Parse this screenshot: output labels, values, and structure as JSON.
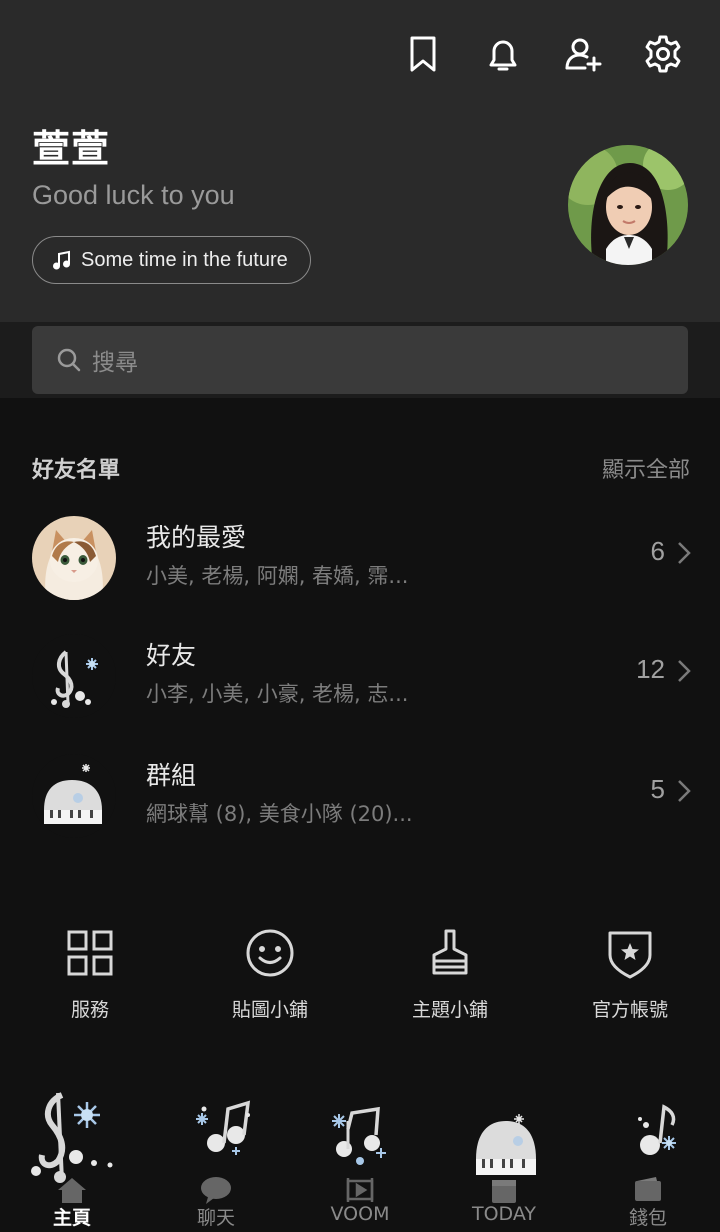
{
  "header": {
    "icons": [
      "bookmark-icon",
      "bell-icon",
      "add-friend-icon",
      "gear-icon"
    ],
    "profile_name": "萱萱",
    "status_message": "Good luck to you",
    "music": "Some time in the future"
  },
  "search": {
    "placeholder": "搜尋"
  },
  "friends": {
    "section_title": "好友名單",
    "show_all": "顯示全部",
    "rows": [
      {
        "title": "我的最愛",
        "subtitle": "小美, 老楊, 阿嫻, 春嬌, 霈...",
        "count": "6",
        "thumb": "cat-avatar"
      },
      {
        "title": "好友",
        "subtitle": "小李, 小美, 小豪, 老楊, 志...",
        "count": "12",
        "thumb": "music-note-theme-icon"
      },
      {
        "title": "群組",
        "subtitle": "網球幫 (8), 美食小隊 (20)...",
        "count": "5",
        "thumb": "snow-piano-theme-icon"
      }
    ]
  },
  "services": [
    {
      "label": "服務",
      "icon": "grid-icon"
    },
    {
      "label": "貼圖小鋪",
      "icon": "smiley-icon"
    },
    {
      "label": "主題小鋪",
      "icon": "brush-icon"
    },
    {
      "label": "官方帳號",
      "icon": "shield-star-icon"
    }
  ],
  "bottom_nav": [
    {
      "label": "主頁",
      "icon": "home-icon",
      "active": true
    },
    {
      "label": "聊天",
      "icon": "chat-icon",
      "active": false
    },
    {
      "label": "VOOM",
      "icon": "voom-icon",
      "active": false
    },
    {
      "label": "TODAY",
      "icon": "today-icon",
      "active": false
    },
    {
      "label": "錢包",
      "icon": "wallet-icon",
      "active": false
    }
  ]
}
